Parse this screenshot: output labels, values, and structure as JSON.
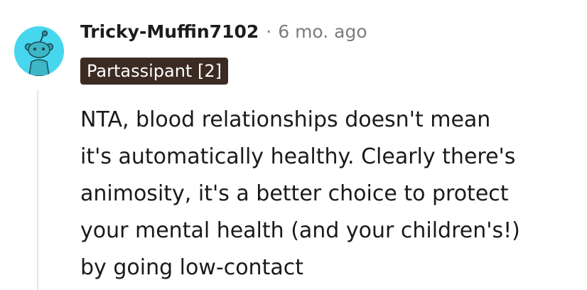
{
  "comment": {
    "author": "Tricky-Muffin7102",
    "separator": "·",
    "timestamp": "6 mo. ago",
    "flair": "Partassipant [2]",
    "avatar_icon": "snoo-avatar-icon",
    "body_lines": [
      "NTA, blood relationships doesn't mean",
      "it's automatically healthy. Clearly there's",
      "animosity, it's a better choice to protect",
      "your mental health (and your children's!)",
      "by going low-contact"
    ]
  },
  "colors": {
    "avatar_background": "#46d7ef",
    "flair_background": "#3b2b22",
    "thread_line": "#e6e6e6",
    "meta_text": "#7c7c7c"
  }
}
